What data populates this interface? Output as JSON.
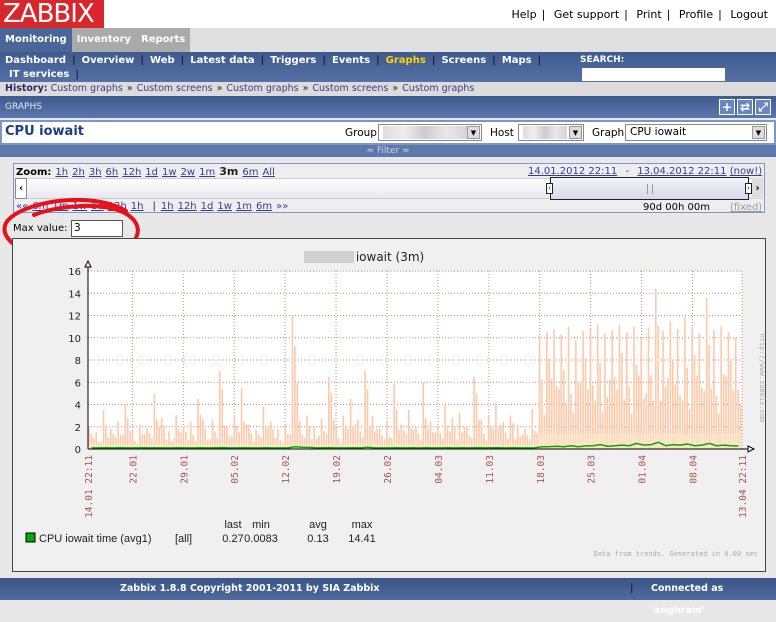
{
  "header": {
    "logo": "ZABBIX",
    "links": [
      "Help",
      "Get support",
      "Print",
      "Profile",
      "Logout"
    ]
  },
  "tabs": [
    "Monitoring",
    "Inventory",
    "Reports"
  ],
  "subnav": {
    "items": [
      "Dashboard",
      "Overview",
      "Web",
      "Latest data",
      "Triggers",
      "Events",
      "Graphs",
      "Screens",
      "Maps"
    ],
    "items2": [
      "IT services"
    ],
    "active": "Graphs",
    "search_label": "SEARCH:",
    "search_value": ""
  },
  "history": {
    "label": "History:",
    "items": [
      "Custom graphs",
      "Custom screens",
      "Custom graphs",
      "Custom screens",
      "Custom graphs"
    ]
  },
  "section": {
    "title": "GRAPHS"
  },
  "page": {
    "title": "CPU iowait",
    "group_label": "Group",
    "host_label": "Host",
    "graph_label": "Graph",
    "graph_value": "CPU iowait"
  },
  "filter": {
    "label": "≈ Filter ≈"
  },
  "zoom": {
    "label": "Zoom:",
    "options": [
      "1h",
      "2h",
      "3h",
      "6h",
      "12h",
      "1d",
      "1w",
      "2w",
      "1m",
      "3m",
      "6m",
      "All"
    ],
    "active": "3m",
    "range_from": "14.01.2012 22:11",
    "range_sep": "-",
    "range_to": "13.04.2012 22:11",
    "now": "(now!)",
    "back": [
      "6m",
      "1m",
      "1w",
      "1d",
      "12h",
      "1h"
    ],
    "forward": [
      "1h",
      "12h",
      "1d",
      "1w",
      "1m",
      "6m"
    ],
    "back_arrows": "««",
    "fwd_arrows": "»»",
    "period": "90d 00h 00m",
    "fixed": "(fixed)"
  },
  "max_value": {
    "label": "Max value:",
    "value": "3"
  },
  "accent": {
    "red": "#d8262a",
    "blue": "#4a6598",
    "spike": "#ffc8a8",
    "avgline": "#00aa00"
  },
  "chart_data": {
    "type": "area",
    "title_suffix": ": CPU iowait  (3m)",
    "ylim": [
      0,
      16
    ],
    "yticks": [
      0,
      2,
      4,
      6,
      8,
      10,
      12,
      14,
      16
    ],
    "xticks": [
      "14.01 22:11",
      "22.01",
      "29.01",
      "05.02",
      "12.02",
      "19.02",
      "26.02",
      "04.03",
      "11.03",
      "18.03",
      "25.03",
      "01.04",
      "08.04",
      "13.04 22:11"
    ],
    "series": [
      {
        "name": "CPU iowait time (avg1)",
        "scope": "[all]",
        "last": "0.27",
        "min": "0.0083",
        "avg": "0.13",
        "max": "14.41",
        "daily_max": [
          2,
          1.5,
          3.5,
          1.8,
          2.5,
          4,
          1.6,
          2.2,
          1.9,
          5,
          2.8,
          1.6,
          3,
          2,
          2.4,
          4.5,
          1.8,
          2.6,
          7,
          2,
          3,
          5.5,
          2.2,
          1.7,
          3.8,
          2.5,
          1.8,
          2.2,
          12,
          2.5,
          3,
          2,
          2.7,
          6.5,
          1.9,
          3,
          4.5,
          2.6,
          7,
          3,
          1.8,
          2.4,
          5.8,
          2.2,
          3.5,
          2,
          6,
          2.5,
          1.9,
          4,
          2.8,
          3.3,
          2,
          6.5,
          2.6,
          3,
          4.2,
          2.4,
          3,
          2.2,
          1.8,
          3.6,
          10.2,
          10.5,
          10.8,
          10.3,
          11,
          9.8,
          10.6,
          10.8,
          11.2,
          10.4,
          10.7,
          11.2,
          10.5,
          11,
          10,
          10.9,
          14.4,
          10.6,
          11.5,
          10.8,
          12,
          11,
          10.4,
          13.6,
          10.7,
          11,
          10.5,
          10
        ],
        "daily_avg": [
          0.1,
          0.1,
          0.12,
          0.1,
          0.11,
          0.1,
          0.1,
          0.12,
          0.1,
          0.12,
          0.1,
          0.1,
          0.11,
          0.1,
          0.1,
          0.12,
          0.1,
          0.11,
          0.13,
          0.1,
          0.1,
          0.12,
          0.1,
          0.1,
          0.11,
          0.1,
          0.1,
          0.1,
          0.2,
          0.15,
          0.14,
          0.1,
          0.12,
          0.12,
          0.1,
          0.1,
          0.12,
          0.1,
          0.15,
          0.1,
          0.1,
          0.1,
          0.12,
          0.1,
          0.11,
          0.1,
          0.12,
          0.1,
          0.1,
          0.11,
          0.1,
          0.12,
          0.1,
          0.13,
          0.1,
          0.11,
          0.12,
          0.1,
          0.11,
          0.1,
          0.1,
          0.12,
          0.2,
          0.22,
          0.25,
          0.2,
          0.3,
          0.2,
          0.28,
          0.3,
          0.4,
          0.25,
          0.3,
          0.35,
          0.3,
          0.5,
          0.35,
          0.4,
          0.6,
          0.3,
          0.4,
          0.35,
          0.45,
          0.3,
          0.35,
          0.5,
          0.3,
          0.35,
          0.3,
          0.27
        ]
      }
    ],
    "legend_headers": [
      "last",
      "min",
      "avg",
      "max"
    ],
    "footnote": "Data from trends. Generated in 0.09 sec",
    "watermark": "http://www.zabbix.com"
  },
  "footer": {
    "copyright": "Zabbix 1.8.8 Copyright 2001-2011 by SIA Zabbix",
    "connected": "Connected as 'anghram'"
  }
}
